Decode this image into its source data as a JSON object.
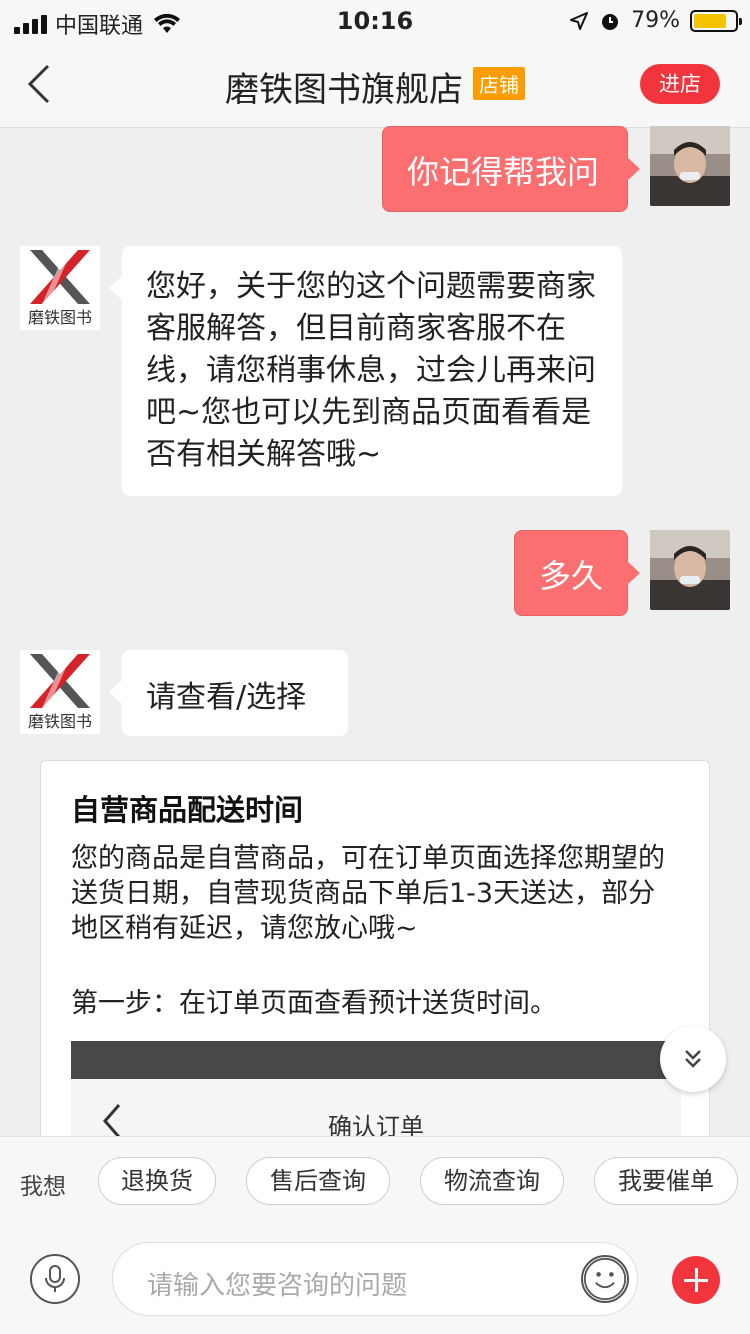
{
  "status_bar": {
    "carrier": "中国联通",
    "time": "10:16",
    "battery": "79%",
    "battery_level": 0.79,
    "icons": [
      "signal-icon",
      "wifi-icon",
      "location-arrow-icon",
      "alarm-icon",
      "battery-icon"
    ]
  },
  "header": {
    "title": "磨铁图书旗舰店",
    "tag": "店铺",
    "enter_button": "进店",
    "brand_color": "#f2343c"
  },
  "shop": {
    "avatar_label": "磨铁图书"
  },
  "messages": [
    {
      "from": "user",
      "text": "你记得帮我问"
    },
    {
      "from": "shop",
      "text": "您好，关于您的这个问题需要商家客服解答，但目前商家客服不在线，请您稍事休息，过会儿再来问吧~您也可以先到商品页面看看是否有相关解答哦~"
    },
    {
      "from": "user",
      "text": "多久"
    },
    {
      "from": "shop",
      "text": "请查看/选择"
    }
  ],
  "card": {
    "title": "自营商品配送时间",
    "body": "您的商品是自营商品，可在订单页面选择您期望的送货日期，自营现货商品下单后1-3天送达，部分地区稍有延迟，请您放心哦~",
    "step": "第一步：在订单页面查看预计送货时间。",
    "image_title": "确认订单"
  },
  "quick_bar": {
    "label": "我想",
    "chips": [
      "退换货",
      "售后查询",
      "物流查询",
      "我要催单"
    ]
  },
  "input_bar": {
    "placeholder": "请输入您要咨询的问题"
  }
}
